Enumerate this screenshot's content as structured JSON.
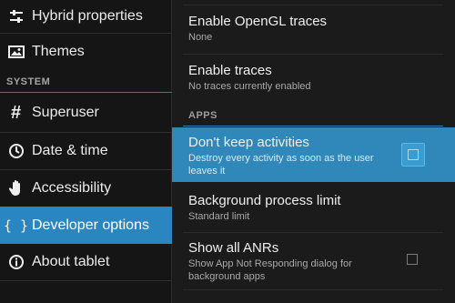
{
  "sidebar": {
    "items": [
      {
        "label": "Hybrid properties",
        "icon": "sliders-icon"
      },
      {
        "label": "Themes",
        "icon": "image-icon"
      },
      {
        "label": "Superuser",
        "icon": "hash-icon"
      },
      {
        "label": "Date & time",
        "icon": "clock-icon"
      },
      {
        "label": "Accessibility",
        "icon": "hand-icon"
      },
      {
        "label": "Developer options",
        "icon": "braces-icon",
        "selected": true
      },
      {
        "label": "About tablet",
        "icon": "info-icon"
      }
    ],
    "section_system": "SYSTEM"
  },
  "content": {
    "opengl": {
      "title": "Enable OpenGL traces",
      "summary": "None"
    },
    "traces": {
      "title": "Enable traces",
      "summary": "No traces currently enabled"
    },
    "section_apps": "APPS",
    "dont_keep": {
      "title": "Don't keep activities",
      "summary": "Destroy every activity as soon as the user leaves it",
      "checked": false
    },
    "bg_limit": {
      "title": "Background process limit",
      "summary": "Standard limit"
    },
    "anrs": {
      "title": "Show all ANRs",
      "summary": "Show App Not Responding dialog for background apps",
      "checked": false
    }
  },
  "colors": {
    "accent": "#2a86c1",
    "active_row": "#2f88b9",
    "background": "#1b1b1b"
  }
}
